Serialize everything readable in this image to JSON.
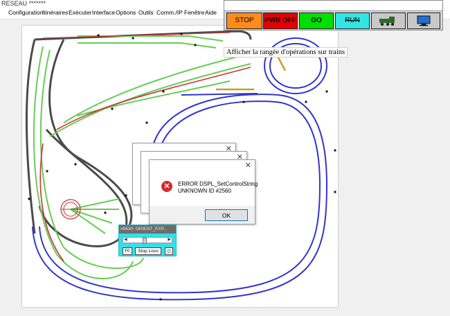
{
  "window": {
    "title": "RESEAU *******"
  },
  "menu": {
    "items": [
      "Configuration",
      "Itinéraires",
      "Exécuter",
      "Interface",
      "Options",
      "Outils",
      "Comm./IP",
      "Fenêtre",
      "Aide"
    ]
  },
  "toolbar": {
    "stop_label": "STOP",
    "pwr_off_label": "PWR OFF",
    "go_label": "GO",
    "run_label": "RUN",
    "colors": {
      "stop": "#ff8c1a",
      "pwr_off": "#e60000",
      "go": "#00e000",
      "run": "#33e6e6",
      "neutral": "#c8c8c8"
    },
    "icons": [
      "locomotive-icon",
      "monitor-icon"
    ]
  },
  "tooltip": {
    "text": "Afficher la rangée d'opérations sur trains"
  },
  "dialog": {
    "line1": "ERROR DSPL_SetControlString",
    "line2": "UNKNOWN ID #2560",
    "ok_label": "OK",
    "close_glyph": "✕"
  },
  "loco_panel": {
    "title": "#5630: ORIENT_EXP...",
    "f0_label": "F0",
    "stop_label": "Stop Loco"
  },
  "track_colors": {
    "main": "#4a4a4a",
    "green": "#66cc55",
    "red": "#cc3333",
    "blue": "#3333cc"
  }
}
